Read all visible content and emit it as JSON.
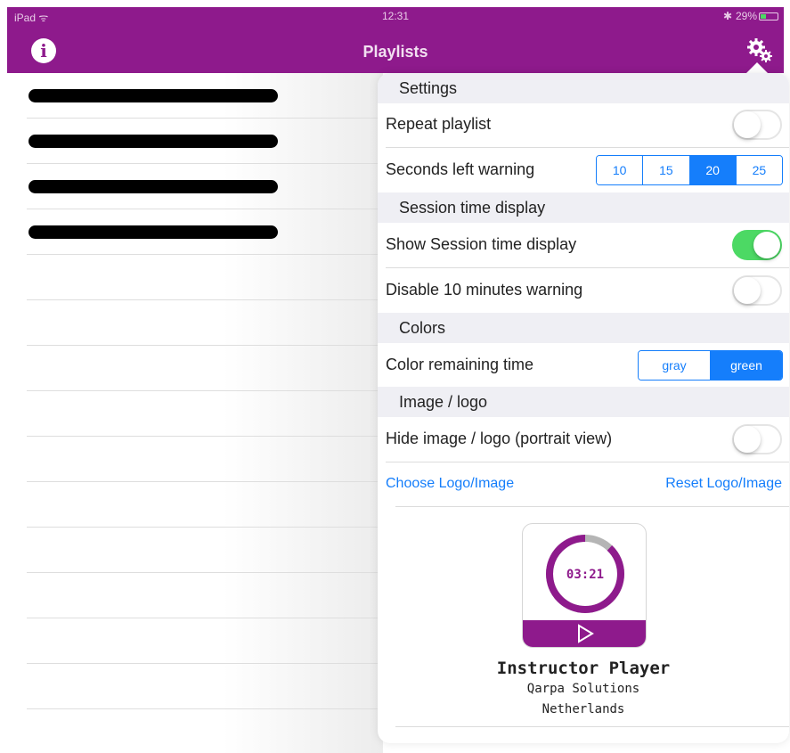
{
  "status_bar": {
    "device": "iPad ᯤ",
    "time": "12:31",
    "bluetooth": "✱",
    "battery": "29%"
  },
  "nav": {
    "title": "Playlists"
  },
  "playlist": {
    "rows": [
      {
        "redacted": true
      },
      {
        "redacted": true
      },
      {
        "redacted": true
      },
      {
        "redacted": true
      },
      {
        "redacted": false
      },
      {
        "redacted": false
      },
      {
        "redacted": false
      },
      {
        "redacted": false
      },
      {
        "redacted": false
      },
      {
        "redacted": false
      },
      {
        "redacted": false
      },
      {
        "redacted": false
      },
      {
        "redacted": false
      },
      {
        "redacted": false
      },
      {
        "redacted": false
      }
    ]
  },
  "settings": {
    "settings_header": "Settings",
    "repeat_playlist": {
      "label": "Repeat playlist",
      "on": false
    },
    "seconds_warning": {
      "label": "Seconds left warning",
      "options": [
        "10",
        "15",
        "20",
        "25"
      ],
      "selected": "20"
    },
    "session_header": "Session time display",
    "show_session": {
      "label": "Show Session time display",
      "on": true
    },
    "disable_warning": {
      "label": "Disable 10 minutes warning",
      "on": false
    },
    "colors_header": "Colors",
    "color_remaining": {
      "label": "Color remaining time",
      "options": [
        "gray",
        "green"
      ],
      "selected": "green"
    },
    "image_header": "Image / logo",
    "hide_image": {
      "label": "Hide image / logo (portrait view)",
      "on": false
    },
    "choose_logo": "Choose Logo/Image",
    "reset_logo": "Reset Logo/Image"
  },
  "logo": {
    "timer": "03:21",
    "timer_progress": 0.88,
    "app_name": "Instructor Player",
    "company": "Qarpa Solutions",
    "country": "Netherlands"
  },
  "colors": {
    "brand": "#8e1a8c",
    "ios_blue": "#157efb",
    "switch_green": "#4cd964",
    "ring_gray": "#b5b5b5"
  }
}
